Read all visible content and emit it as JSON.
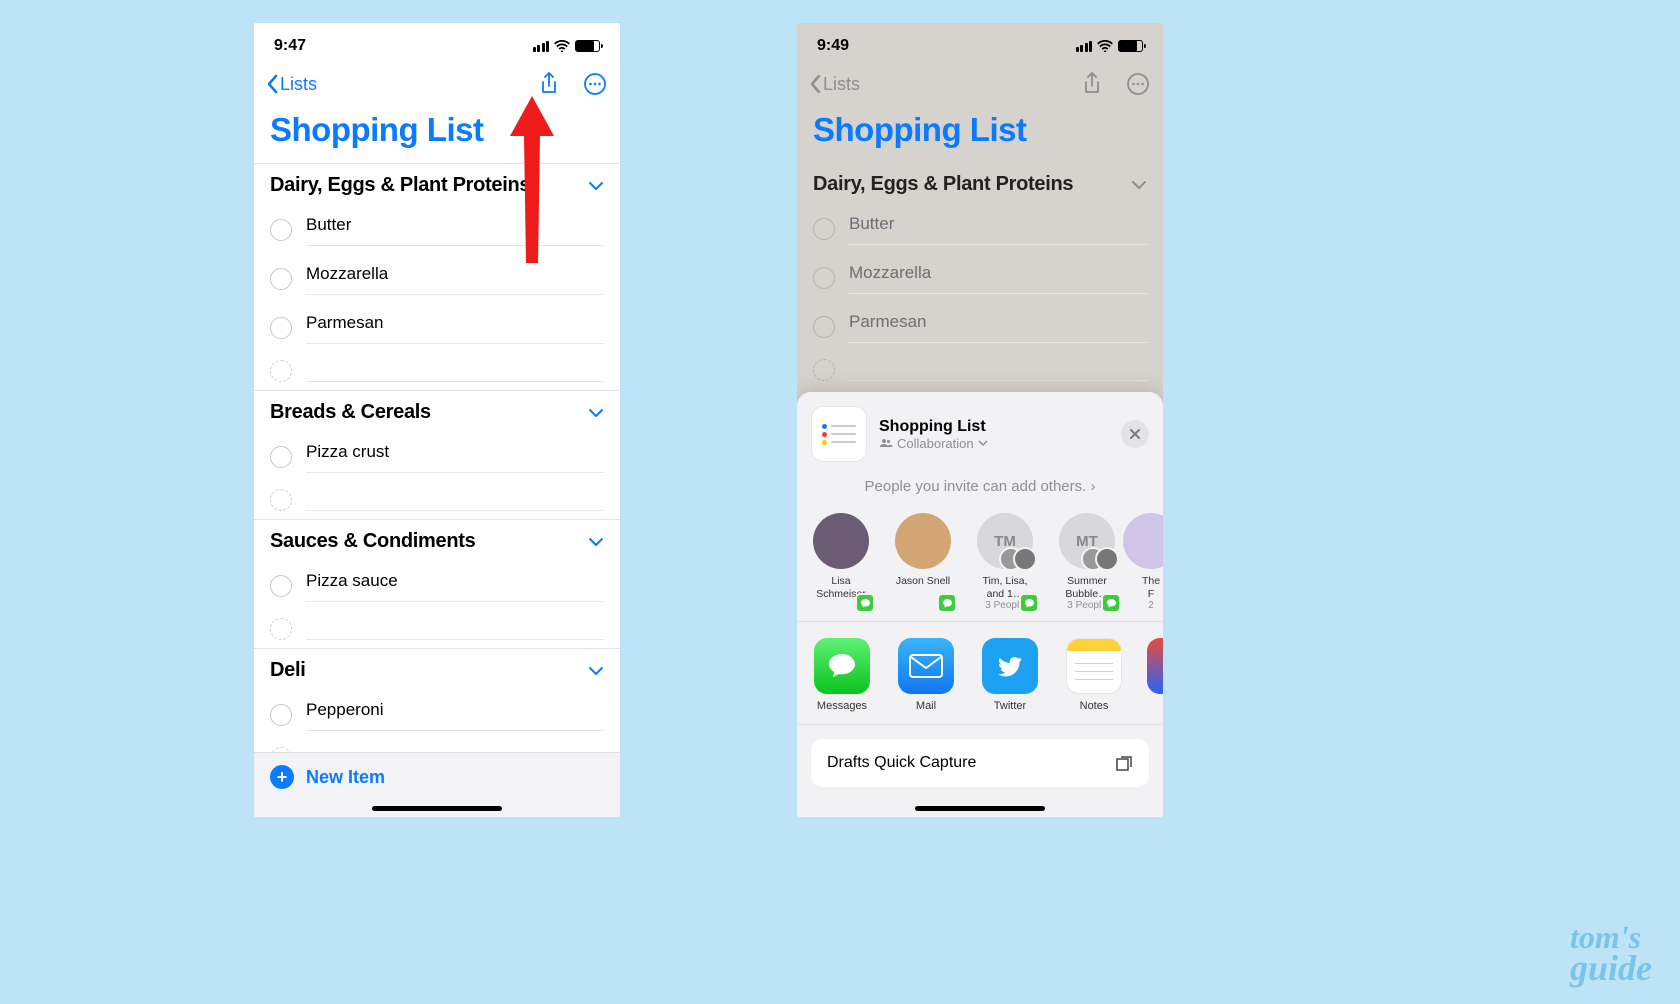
{
  "colors": {
    "accent": "#0a7aff",
    "bg": "#bde3f7"
  },
  "watermark": {
    "line1": "tom's",
    "line2": "guide"
  },
  "left": {
    "statusTime": "9:47",
    "backLabel": "Lists",
    "title": "Shopping List",
    "sections": [
      {
        "title": "Dairy, Eggs & Plant Proteins",
        "items": [
          "Butter",
          "Mozzarella",
          "Parmesan"
        ]
      },
      {
        "title": "Breads & Cereals",
        "items": [
          "Pizza crust"
        ]
      },
      {
        "title": "Sauces & Condiments",
        "items": [
          "Pizza sauce"
        ]
      },
      {
        "title": "Deli",
        "items": [
          "Pepperoni"
        ]
      }
    ],
    "newItemLabel": "New Item"
  },
  "right": {
    "statusTime": "9:49",
    "backLabel": "Lists",
    "title": "Shopping List",
    "sections": [
      {
        "title": "Dairy, Eggs & Plant Proteins",
        "items": [
          "Butter",
          "Mozzarella",
          "Parmesan"
        ]
      }
    ],
    "share": {
      "name": "Shopping List",
      "subLabel": "Collaboration",
      "info": "People you invite can add others.",
      "contacts": [
        {
          "name": "Lisa Schmeiser",
          "sub": ""
        },
        {
          "name": "Jason Snell",
          "sub": ""
        },
        {
          "name": "Tim, Lisa, and 1…",
          "sub": "3 People",
          "initials": "TM"
        },
        {
          "name": "Summer Bubble…",
          "sub": "3 People",
          "initials": "MT"
        },
        {
          "name": "The F",
          "sub": "2"
        }
      ],
      "apps": [
        {
          "label": "Messages"
        },
        {
          "label": "Mail"
        },
        {
          "label": "Twitter"
        },
        {
          "label": "Notes"
        }
      ],
      "action1": "Drafts Quick Capture"
    }
  }
}
